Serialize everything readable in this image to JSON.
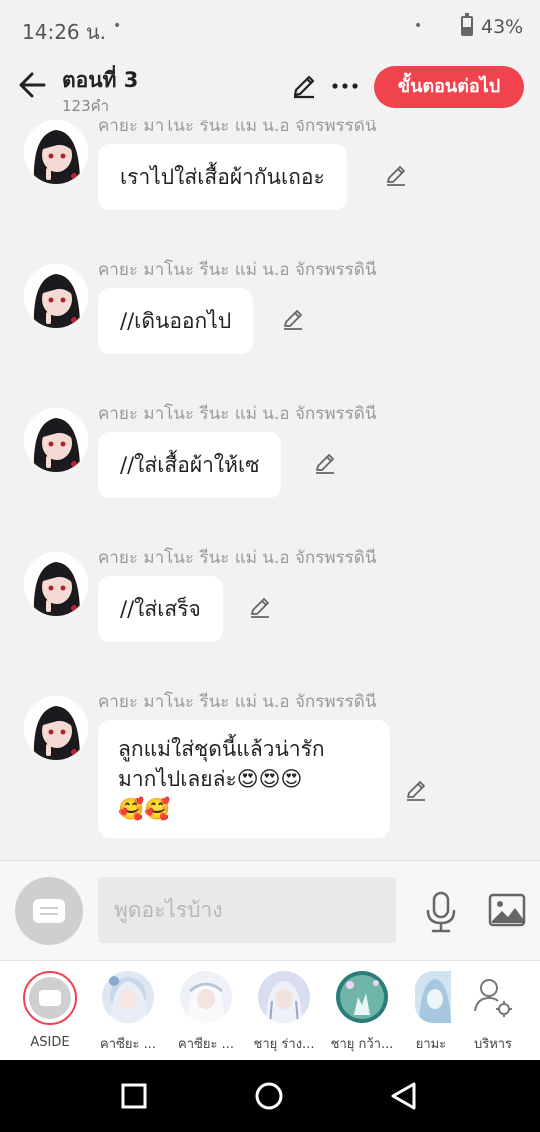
{
  "status": {
    "time": "14:26 น.",
    "dot": "•",
    "dot2": "•",
    "battery": "43%"
  },
  "header": {
    "title": "ตอนที่ 3",
    "subtitle": "123คำ",
    "next_label": "ขั้นตอนต่อไป"
  },
  "messages": [
    {
      "sender": "คายะ มาโนะ รีนะ แม่ น.อ จักรพรรดินี",
      "lines": [
        "เราไปใส่เสื้อผ้ากันเถอะ"
      ]
    },
    {
      "sender": "คายะ มาโนะ รีนะ แม่ น.อ จักรพรรดินี",
      "lines": [
        "//เดินออกไป"
      ]
    },
    {
      "sender": "คายะ มาโนะ รีนะ แม่ น.อ จักรพรรดินี",
      "lines": [
        "//ใส่เสื้อผ้าให้เซ"
      ]
    },
    {
      "sender": "คายะ มาโนะ รีนะ แม่ น.อ จักรพรรดินี",
      "lines": [
        "//ใส่เสร็จ"
      ]
    },
    {
      "sender": "คายะ มาโนะ รีนะ แม่ น.อ จักรพรรดินี",
      "lines": [
        "ลูกแม่ใส่ชุดนี้แล้วน่ารัก",
        "มากไปเลยล่ะ😍😍😍",
        "🥰🥰"
      ]
    }
  ],
  "composer": {
    "placeholder": "พูดอะไรบ้าง"
  },
  "characters": [
    {
      "label": "ASIDE"
    },
    {
      "label": "คาซียะ ..."
    },
    {
      "label": "คาซียะ ..."
    },
    {
      "label": "ชายุ ร่าง..."
    },
    {
      "label": "ชายุ กว้า..."
    },
    {
      "label": "ยามะ"
    },
    {
      "label": "บริหาร"
    }
  ],
  "colors": {
    "accent": "#f0434e",
    "background": "#f2f2f2"
  },
  "icons": [
    "back-arrow-icon",
    "pencil-icon",
    "more-icon",
    "mic-icon",
    "image-icon",
    "settings-user-icon",
    "square-icon",
    "circle-icon",
    "triangle-back-icon"
  ]
}
